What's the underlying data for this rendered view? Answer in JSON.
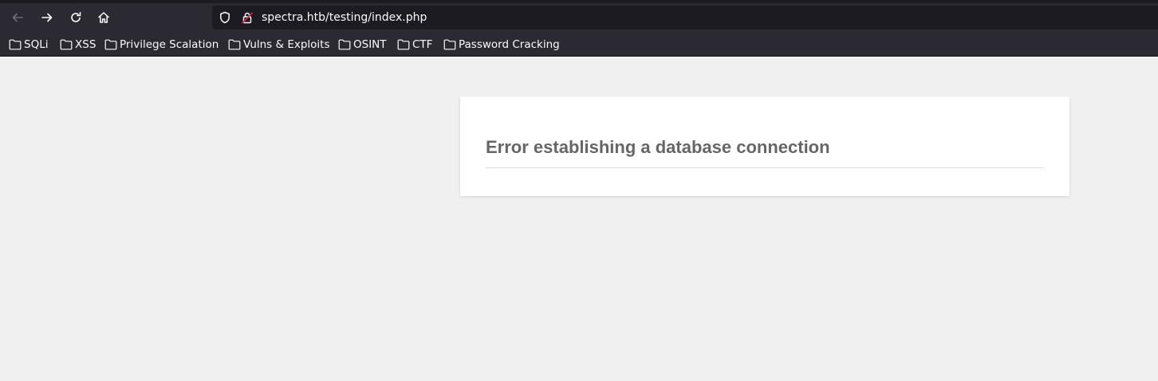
{
  "browser": {
    "url": "spectra.htb/testing/index.php",
    "icons": {
      "back": "arrow-left-icon",
      "forward": "arrow-right-icon",
      "reload": "reload-icon",
      "home": "home-icon",
      "shield": "shield-icon",
      "lock": "insecure-lock-icon"
    },
    "colors": {
      "toolbar": "#2b2a33",
      "urlbar": "#1c1b22",
      "text": "#fbfbfe",
      "insecure_accent": "#e22850"
    }
  },
  "bookmarks": [
    {
      "label": "SQLi"
    },
    {
      "label": "XSS"
    },
    {
      "label": "Privilege Scalation"
    },
    {
      "label": "Vulns & Exploits"
    },
    {
      "label": "OSINT"
    },
    {
      "label": "CTF"
    },
    {
      "label": "Password Cracking"
    }
  ],
  "page": {
    "error_title": "Error establishing a database connection",
    "colors": {
      "background": "#f0f0f0",
      "card": "#ffffff",
      "title": "#666666"
    }
  }
}
